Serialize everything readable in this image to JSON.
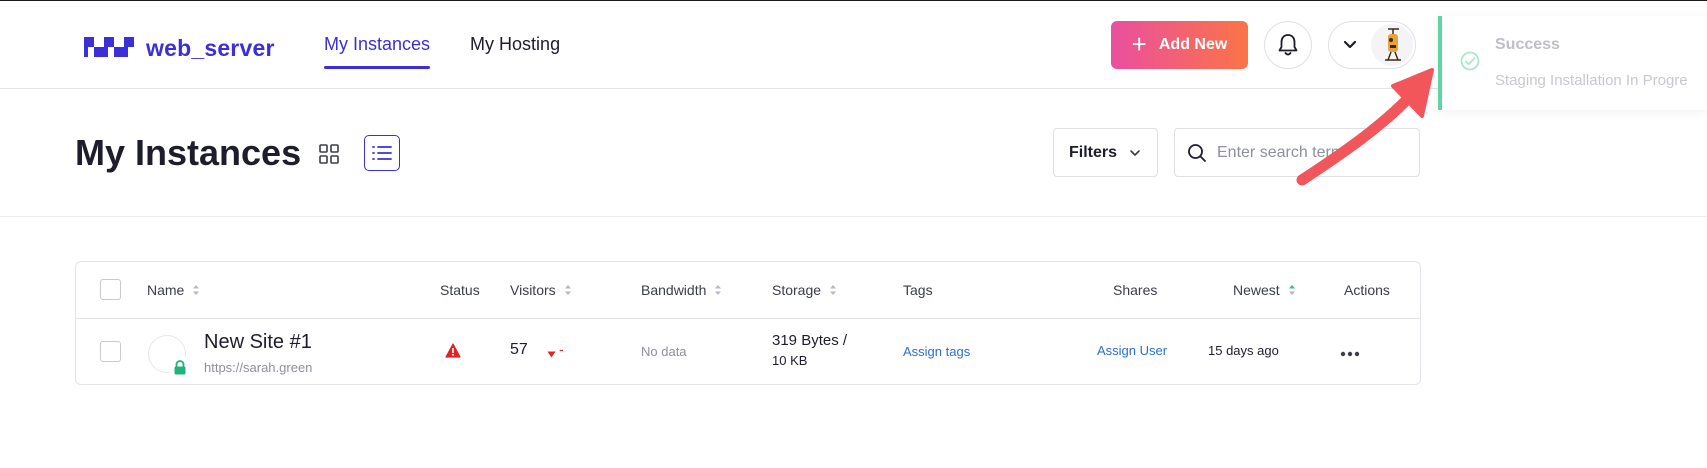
{
  "app": {
    "brand": "web_server",
    "brand_color": "#3a2fd9",
    "nav": [
      {
        "label": "My Instances",
        "active": true
      },
      {
        "label": "My Hosting",
        "active": false
      }
    ],
    "add_button": "Add New",
    "icons": {
      "bell": "bell-icon",
      "chevron": "chevron-down-icon",
      "avatar": "user-avatar"
    }
  },
  "toast": {
    "title": "Success",
    "message": "Staging Installation In Progre",
    "accent": "#5ed6a4"
  },
  "page": {
    "title": "My Instances",
    "view_modes": [
      "grid-view",
      "list-view"
    ],
    "active_view": "list-view",
    "filters_label": "Filters",
    "search_placeholder": "Enter search term"
  },
  "table": {
    "columns": [
      "Name",
      "Status",
      "Visitors",
      "Bandwidth",
      "Storage",
      "Tags",
      "Shares",
      "Newest",
      "Actions"
    ],
    "rows": [
      {
        "name": "New Site #1",
        "url": "https://sarah.green",
        "status_icon": "warning-icon",
        "visitors": "57",
        "visitors_trend": "-",
        "bandwidth": "No data",
        "storage_line1": "319 Bytes /",
        "storage_line2": "10 KB",
        "tags": "Assign tags",
        "shares": "Assign User",
        "newest": "15 days ago",
        "actions_icon": "more-icon"
      }
    ]
  },
  "colors": {
    "gradient_start": "#ea4fa0",
    "gradient_end": "#fb7446",
    "warning": "#e02424",
    "arrow": "#f2555a",
    "link": "#2a6fd6"
  }
}
